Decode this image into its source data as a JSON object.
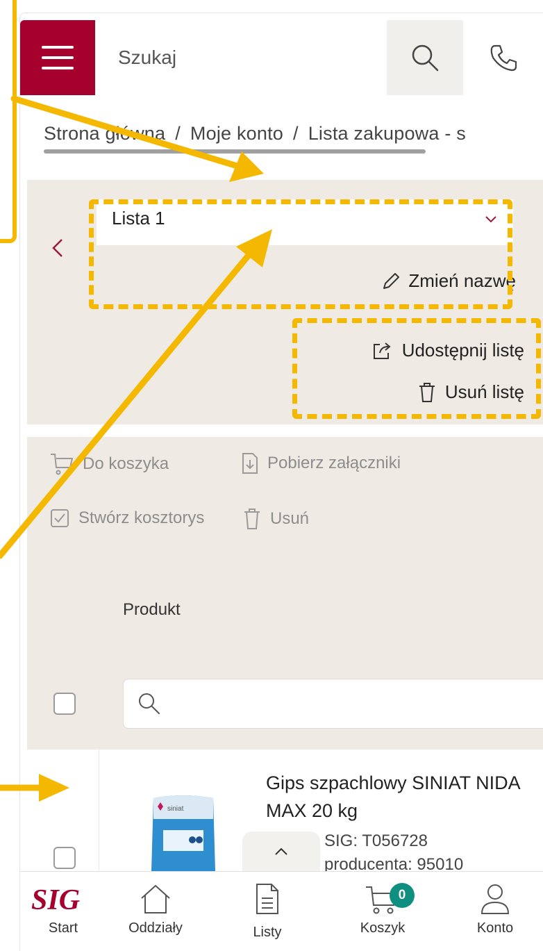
{
  "header": {
    "search_placeholder": "Szukaj"
  },
  "breadcrumb": {
    "items": [
      "Strona główna",
      "Moje konto",
      "Lista zakupowa - s"
    ],
    "separator": "/"
  },
  "list_panel": {
    "selected_list": "Lista 1",
    "rename_label": "Zmień nazwę",
    "share_label": "Udostępnij listę",
    "delete_label": "Usuń listę"
  },
  "toolbar": {
    "add_to_cart": "Do koszyka",
    "download_attachments": "Pobierz załączniki",
    "create_estimate": "Stwórz kosztorys",
    "delete": "Usuń"
  },
  "table": {
    "column_product": "Produkt",
    "filter_value": ""
  },
  "product": {
    "name": "Gips szpachlowy SINIAT NIDA MAX 20 kg",
    "sku": "SIG: T056728",
    "producer_code": "producenta: 95010",
    "brand_text": "siniat"
  },
  "bottom_nav": {
    "start": "Start",
    "branches": "Oddziały",
    "lists": "Listy",
    "cart": "Koszyk",
    "account": "Konto",
    "cart_count": "0",
    "logo_text": "SIG"
  },
  "colors": {
    "brand_red": "#a6002e",
    "panel_beige": "#efebe4",
    "badge_teal": "#0e8f7f",
    "annotation_yellow": "#f5b800"
  },
  "icons": [
    "menu-icon",
    "search-icon",
    "phone-icon",
    "chevron-left-icon",
    "chevron-down-icon",
    "pencil-icon",
    "share-icon",
    "trash-icon",
    "cart-icon",
    "download-icon",
    "estimate-icon",
    "chevron-up-icon",
    "home-icon",
    "document-icon",
    "user-icon"
  ]
}
